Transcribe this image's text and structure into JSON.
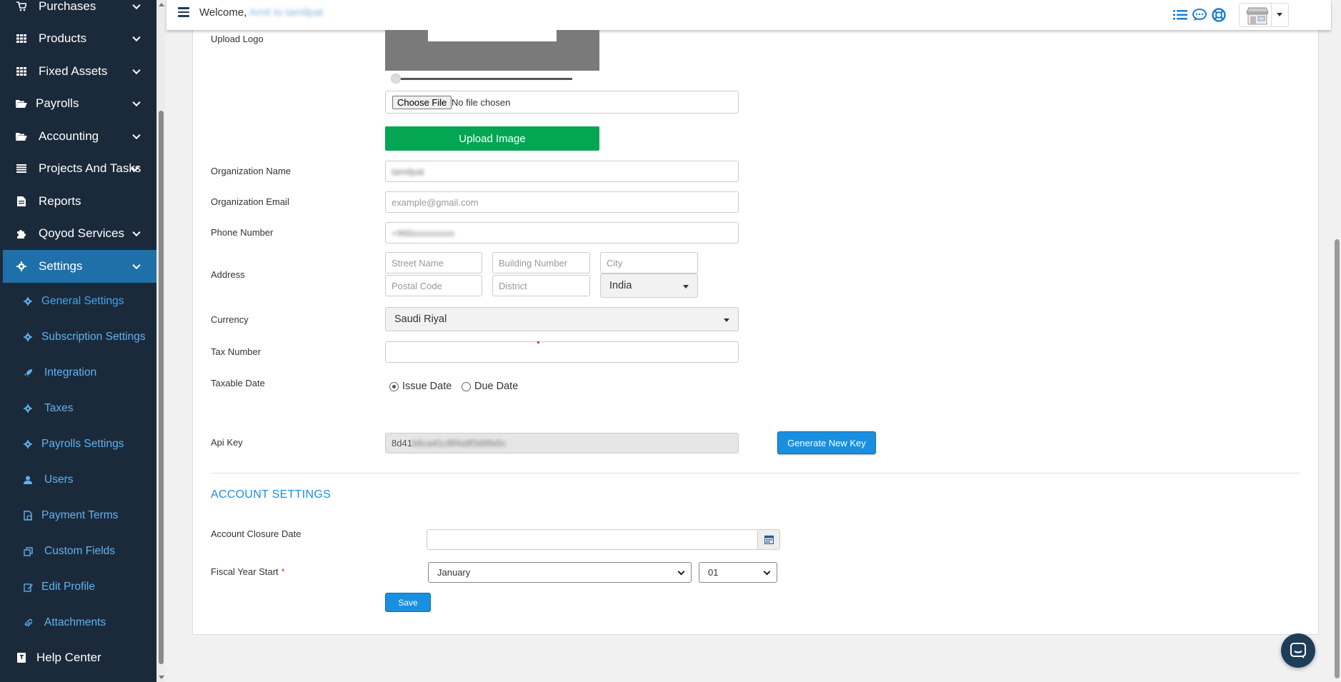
{
  "header": {
    "welcome_prefix": "Welcome,",
    "welcome_user": "Amit",
    "welcome_to": "to",
    "welcome_org": "tamilpat"
  },
  "sidebar": {
    "items": [
      {
        "label": "Purchases",
        "icon": "cart-icon"
      },
      {
        "label": "Products",
        "icon": "grid-icon"
      },
      {
        "label": "Fixed Assets",
        "icon": "grid-icon"
      },
      {
        "label": "Payrolls",
        "icon": "folder-open-icon"
      },
      {
        "label": "Accounting",
        "icon": "folder-open-icon"
      },
      {
        "label": "Projects And Tasks",
        "icon": "list-icon"
      },
      {
        "label": "Reports",
        "icon": "document-icon"
      },
      {
        "label": "Qoyod Services",
        "icon": "puzzle-icon"
      },
      {
        "label": "Settings",
        "icon": "gear-icon"
      }
    ],
    "sub_items": [
      {
        "label": "General Settings",
        "icon": "gear-icon"
      },
      {
        "label": "Subscription Settings",
        "icon": "gear-icon"
      },
      {
        "label": "Integration",
        "icon": "rocket-icon"
      },
      {
        "label": "Taxes",
        "icon": "gear-icon"
      },
      {
        "label": "Payrolls Settings",
        "icon": "gear-icon"
      },
      {
        "label": "Users",
        "icon": "user-icon"
      },
      {
        "label": "Payment Terms",
        "icon": "payment-terms-icon"
      },
      {
        "label": "Custom Fields",
        "icon": "copy-icon"
      },
      {
        "label": "Edit Profile",
        "icon": "edit-icon"
      },
      {
        "label": "Attachments",
        "icon": "paperclip-icon"
      }
    ],
    "help": {
      "label": "Help Center",
      "icon": "book-icon"
    }
  },
  "form": {
    "upload_logo_label": "Upload Logo",
    "choose_file": "Choose File",
    "file_status": "No file chosen",
    "upload_button": "Upload Image",
    "org_name_label": "Organization Name",
    "org_name_value": "tamilpat",
    "org_email_label": "Organization Email",
    "org_email_placeholder": "example@gmail.com",
    "phone_label": "Phone Number",
    "phone_value": "+966xxxxxxxxx",
    "address_label": "Address",
    "street_placeholder": "Street Name",
    "building_placeholder": "Building Number",
    "city_placeholder": "City",
    "postal_placeholder": "Postal Code",
    "district_placeholder": "District",
    "country_value": "India",
    "currency_label": "Currency",
    "currency_value": "Saudi Riyal",
    "tax_label": "Tax Number",
    "tax_value": "",
    "taxable_date_label": "Taxable Date",
    "taxable_options": [
      "Issue Date",
      "Due Date"
    ],
    "taxable_selected": "Issue Date",
    "api_label": "Api Key",
    "api_prefix": "8d41",
    "api_hidden": "b6ca41c8f4a9f3d9fa5c",
    "generate_button": "Generate New Key"
  },
  "account": {
    "title": "ACCOUNT SETTINGS",
    "closure_label": "Account Closure Date",
    "closure_value": "",
    "fiscal_label": "Fiscal Year Start",
    "fiscal_required": "*",
    "fiscal_month": "January",
    "fiscal_day": "01",
    "save_button": "Save"
  },
  "colors": {
    "sidebar_bg": "#1b2a3a",
    "active_bg": "#1f6fa8",
    "sub_text": "#5fb3f0",
    "accent": "#1a8fe0",
    "upload_green": "#04a653"
  }
}
